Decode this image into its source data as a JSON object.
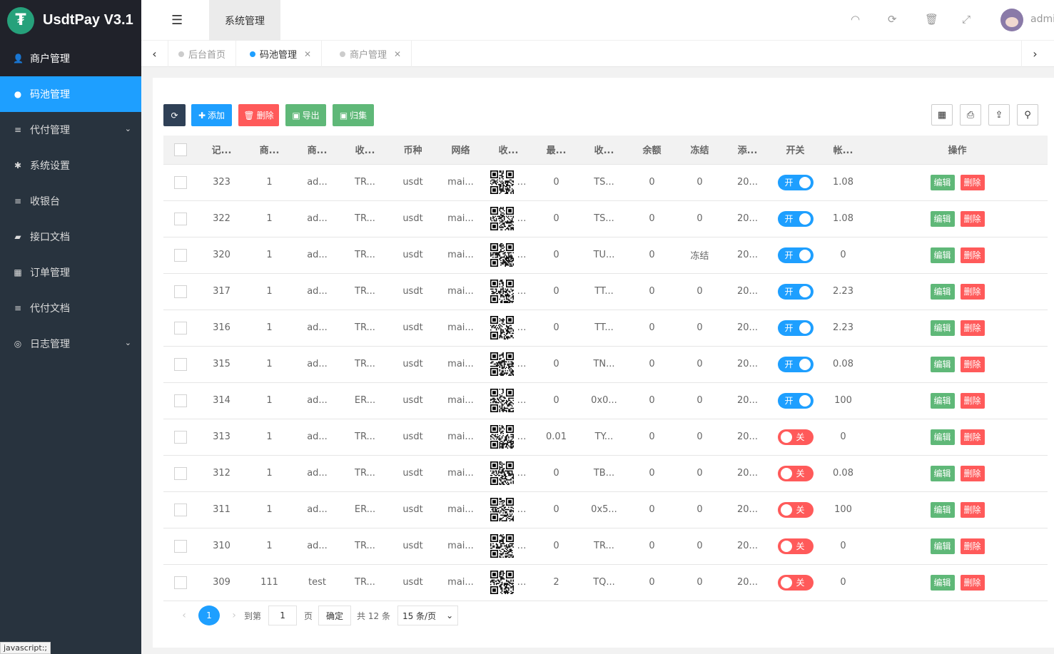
{
  "app": {
    "title": "UsdtPay V3.1",
    "logo_glyph": "₮"
  },
  "sidebar": {
    "items": [
      {
        "label": "商户管理",
        "icon": "user-icon",
        "glyph": "👤"
      },
      {
        "label": "码池管理",
        "icon": "android-icon",
        "glyph": "●"
      },
      {
        "label": "代付管理",
        "icon": "list-icon",
        "glyph": "≡"
      },
      {
        "label": "系统设置",
        "icon": "gear-icon",
        "glyph": "✱"
      },
      {
        "label": "收银台",
        "icon": "list-icon",
        "glyph": "≡"
      },
      {
        "label": "接口文档",
        "icon": "book-icon",
        "glyph": "▰"
      },
      {
        "label": "订单管理",
        "icon": "calculator-icon",
        "glyph": "▦"
      },
      {
        "label": "代付文档",
        "icon": "align-icon",
        "glyph": "≡"
      },
      {
        "label": "日志管理",
        "icon": "dashboard-icon",
        "glyph": "◎"
      }
    ],
    "active_index": 1
  },
  "header": {
    "tab": "系统管理",
    "user": "admin"
  },
  "tabs": [
    {
      "label": "后台首页"
    },
    {
      "label": "码池管理"
    },
    {
      "label": "商户管理"
    }
  ],
  "toolbar": {
    "refresh_glyph": "⟳",
    "add_label": "添加",
    "delete_label": "删除",
    "export_label": "导出",
    "collect_label": "归集"
  },
  "table": {
    "columns": [
      "记...",
      "商...",
      "商...",
      "收...",
      "币种",
      "网络",
      "收...",
      "最...",
      "收...",
      "余额",
      "冻结",
      "添...",
      "开关",
      "帐...",
      "操作"
    ],
    "rows": [
      {
        "id": "323",
        "mid": "1",
        "mname": "ad...",
        "recv": "TR...",
        "coin": "usdt",
        "net": "mai...",
        "min": "0",
        "addr": "TS...",
        "bal": "0",
        "frozen": "0",
        "added": "20...",
        "on": true,
        "acct": "1.08"
      },
      {
        "id": "322",
        "mid": "1",
        "mname": "ad...",
        "recv": "TR...",
        "coin": "usdt",
        "net": "mai...",
        "min": "0",
        "addr": "TS...",
        "bal": "0",
        "frozen": "0",
        "added": "20...",
        "on": true,
        "acct": "1.08"
      },
      {
        "id": "320",
        "mid": "1",
        "mname": "ad...",
        "recv": "TR...",
        "coin": "usdt",
        "net": "mai...",
        "min": "0",
        "addr": "TU...",
        "bal": "0",
        "frozen": "冻结",
        "added": "20...",
        "on": true,
        "acct": "0"
      },
      {
        "id": "317",
        "mid": "1",
        "mname": "ad...",
        "recv": "TR...",
        "coin": "usdt",
        "net": "mai...",
        "min": "0",
        "addr": "TT...",
        "bal": "0",
        "frozen": "0",
        "added": "20...",
        "on": true,
        "acct": "2.23"
      },
      {
        "id": "316",
        "mid": "1",
        "mname": "ad...",
        "recv": "TR...",
        "coin": "usdt",
        "net": "mai...",
        "min": "0",
        "addr": "TT...",
        "bal": "0",
        "frozen": "0",
        "added": "20...",
        "on": true,
        "acct": "2.23"
      },
      {
        "id": "315",
        "mid": "1",
        "mname": "ad...",
        "recv": "TR...",
        "coin": "usdt",
        "net": "mai...",
        "min": "0",
        "addr": "TN...",
        "bal": "0",
        "frozen": "0",
        "added": "20...",
        "on": true,
        "acct": "0.08"
      },
      {
        "id": "314",
        "mid": "1",
        "mname": "ad...",
        "recv": "ER...",
        "coin": "usdt",
        "net": "mai...",
        "min": "0",
        "addr": "0x0...",
        "bal": "0",
        "frozen": "0",
        "added": "20...",
        "on": true,
        "acct": "100"
      },
      {
        "id": "313",
        "mid": "1",
        "mname": "ad...",
        "recv": "TR...",
        "coin": "usdt",
        "net": "mai...",
        "min": "0.01",
        "addr": "TY...",
        "bal": "0",
        "frozen": "0",
        "added": "20...",
        "on": false,
        "acct": "0"
      },
      {
        "id": "312",
        "mid": "1",
        "mname": "ad...",
        "recv": "TR...",
        "coin": "usdt",
        "net": "mai...",
        "min": "0",
        "addr": "TB...",
        "bal": "0",
        "frozen": "0",
        "added": "20...",
        "on": false,
        "acct": "0.08"
      },
      {
        "id": "311",
        "mid": "1",
        "mname": "ad...",
        "recv": "ER...",
        "coin": "usdt",
        "net": "mai...",
        "min": "0",
        "addr": "0x5...",
        "bal": "0",
        "frozen": "0",
        "added": "20...",
        "on": false,
        "acct": "100"
      },
      {
        "id": "310",
        "mid": "1",
        "mname": "ad...",
        "recv": "TR...",
        "coin": "usdt",
        "net": "mai...",
        "min": "0",
        "addr": "TR...",
        "bal": "0",
        "frozen": "0",
        "added": "20...",
        "on": false,
        "acct": "0"
      },
      {
        "id": "309",
        "mid": "111",
        "mname": "test",
        "recv": "TR...",
        "coin": "usdt",
        "net": "mai...",
        "min": "2",
        "addr": "TQ...",
        "bal": "0",
        "frozen": "0",
        "added": "20...",
        "on": false,
        "acct": "0"
      }
    ],
    "switch_on_label": "开",
    "switch_off_label": "关",
    "edit_label": "编辑",
    "delete_label": "删除"
  },
  "pager": {
    "current": "1",
    "goto_label": "到第",
    "page_input": "1",
    "page_unit": "页",
    "confirm": "确定",
    "total": "共 12 条",
    "page_size": "15 条/页"
  },
  "statusbar": "javascript:;"
}
